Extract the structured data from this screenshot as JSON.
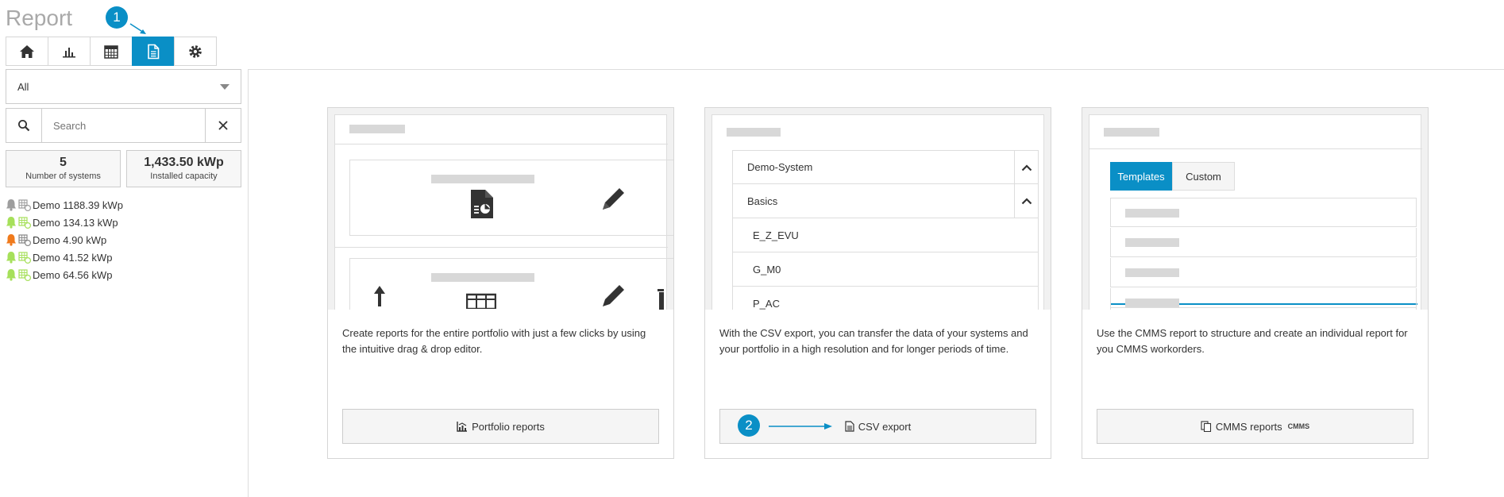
{
  "header": {
    "title": "Report"
  },
  "steps": {
    "step1": "1",
    "step2": "2"
  },
  "toolbar": {
    "active_index": 3,
    "items": [
      "home-icon",
      "bar-chart-icon",
      "calendar-icon",
      "report-document-icon",
      "gear-icon"
    ]
  },
  "filter": {
    "selected": "All"
  },
  "search": {
    "placeholder": "Search"
  },
  "stats": {
    "systems_value": "5",
    "systems_label": "Number of systems",
    "capacity_value": "1,433.50 kWp",
    "capacity_label": "Installed capacity"
  },
  "systems": [
    {
      "label": "Demo 1188.39 kWp",
      "status_color": "#9e9e9e"
    },
    {
      "label": "Demo 134.13 kWp",
      "status_color": "#a6e05a"
    },
    {
      "label": "Demo 4.90 kWp",
      "status_color": "#f07a1c"
    },
    {
      "label": "Demo 41.52 kWp",
      "status_color": "#a6e05a"
    },
    {
      "label": "Demo 64.56 kWp",
      "status_color": "#a6e05a"
    }
  ],
  "cards": {
    "portfolio": {
      "description": "Create reports for the entire portfolio with just a few clicks by using the intuitive drag & drop editor.",
      "button": "Portfolio reports"
    },
    "csv": {
      "description": "With the CSV export, you can transfer the data of your systems and your portfolio in a high resolution and for longer periods of time.",
      "button": "CSV export",
      "tree": [
        "Demo-System",
        "Basics",
        "E_Z_EVU",
        "G_M0",
        "P_AC"
      ]
    },
    "cmms": {
      "description": "Use the CMMS report to structure and create an individual report for you CMMS workorders.",
      "button": "CMMS reports",
      "button_tag": "CMMS",
      "tabs": [
        "Templates",
        "Custom"
      ]
    }
  },
  "colors": {
    "accent": "#0a8fc6"
  }
}
